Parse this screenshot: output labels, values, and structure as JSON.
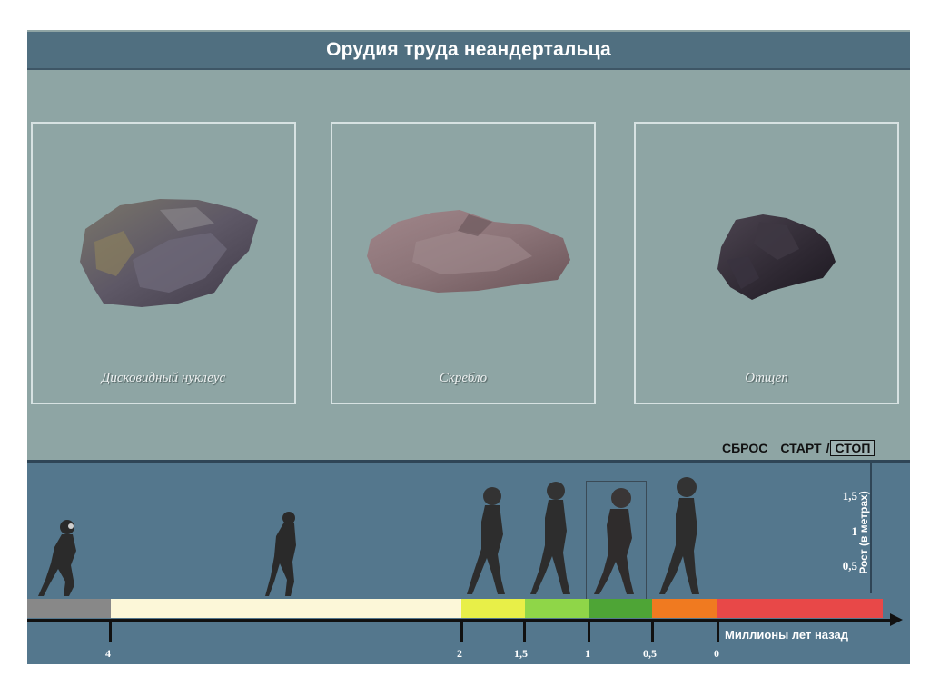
{
  "header": {
    "title": "Орудия труда неандертальца"
  },
  "tools": [
    {
      "label": "Дисковидный нуклеус",
      "icon": "discoid-core-stone-icon"
    },
    {
      "label": "Скребло",
      "icon": "scraper-stone-icon"
    },
    {
      "label": "Отщеп",
      "icon": "flake-stone-icon"
    }
  ],
  "controls": {
    "reset": "СБРОС",
    "start": "СТАРТ",
    "separator": "/",
    "stop": "СТОП"
  },
  "height_scale": {
    "title": "Рост (в метрах)",
    "ticks": [
      "1,5",
      "1",
      "0,5"
    ]
  },
  "timeline": {
    "caption": "Миллионы лет назад",
    "ticks": [
      "4",
      "2",
      "1,5",
      "1",
      "0,5",
      "0"
    ],
    "colors": {
      "gray": "#888888",
      "cream": "#fcf7d8",
      "yellow": "#e8ef48",
      "lightgreen": "#8fd648",
      "green": "#4ea536",
      "orange": "#f07a20",
      "red": "#e84848"
    }
  },
  "colors": {
    "title_bar": "#506f80",
    "panel": "#8ea5a4",
    "timeline_bg": "#54778d"
  }
}
